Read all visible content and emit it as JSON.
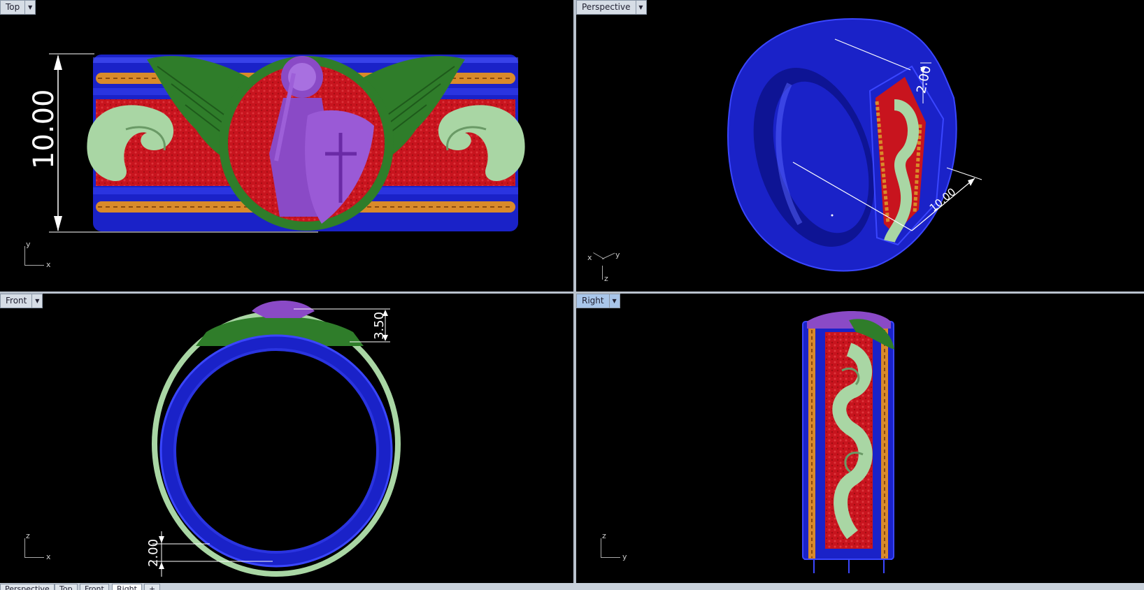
{
  "viewports": {
    "top": {
      "label": "Top",
      "dim_label": "10.00",
      "axis_x": "x",
      "axis_y": "y"
    },
    "perspective": {
      "label": "Perspective",
      "dim_small": "2.00",
      "dim_large": "10.00",
      "axis_x": "x",
      "axis_y": "y",
      "axis_z": "z"
    },
    "front": {
      "label": "Front",
      "dim_top": "3.50",
      "dim_bottom": "2.00",
      "axis_x": "x",
      "axis_z": "z"
    },
    "right": {
      "label": "Right",
      "axis_y": "y",
      "axis_z": "z"
    }
  },
  "tabs": [
    {
      "label": "Perspective"
    },
    {
      "label": "Top"
    },
    {
      "label": "Front"
    },
    {
      "label": "Right"
    }
  ],
  "tab_add": "+",
  "colors": {
    "viewport_bg": "#000000",
    "ring_blue": "#1a22c8",
    "rope_orange": "#d98a2a",
    "inlay_red": "#c8141e",
    "wings_green": "#2f7d2a",
    "scroll_mint": "#a9d6a4",
    "figure_purple": "#8a4ac6",
    "active_label": "#a9c6ea"
  }
}
